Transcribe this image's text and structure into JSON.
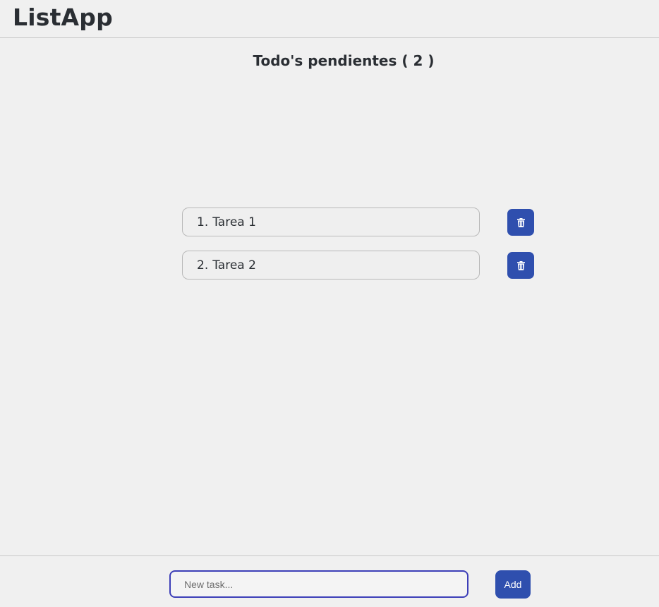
{
  "header": {
    "app_title": "ListApp"
  },
  "main": {
    "heading": "Todo's pendientes ( 2 )",
    "todos": [
      {
        "number": "1.",
        "label": "Tarea 1",
        "delete_icon": "trash-icon"
      },
      {
        "number": "2.",
        "label": "Tarea 2",
        "delete_icon": "trash-icon"
      }
    ]
  },
  "footer": {
    "task_input": {
      "value": "",
      "placeholder": "New task..."
    },
    "add_label": "Add"
  },
  "colors": {
    "background": "#f0f0f0",
    "accent": "#2f4fae",
    "input_focus_border": "#3d3fb8",
    "text": "#2a2e33"
  }
}
